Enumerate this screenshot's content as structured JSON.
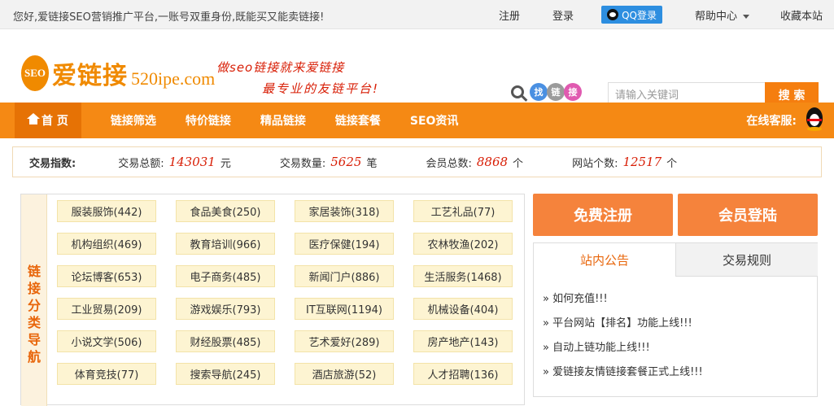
{
  "topbar": {
    "welcome": "您好,爱链接SEO营销推广平台,一账号双重身份,既能买又能卖链接!",
    "register": "注册",
    "login": "登录",
    "qq_login": "QQ登录",
    "help": "帮助中心",
    "bookmark": "收藏本站"
  },
  "logo": {
    "badge": "SEO",
    "name": "爱链接",
    "domain": "520ipe.com"
  },
  "slogan": {
    "line1": "做seo链接就来爱链接",
    "line2": "最专业的友链平台!"
  },
  "search": {
    "deco": [
      "找",
      "链",
      "接"
    ],
    "deco_colors": [
      "#4a90e2",
      "#9b9b9b",
      "#e05ab0"
    ],
    "placeholder": "请输入关键词",
    "button": "搜 索"
  },
  "nav": {
    "home": "首 页",
    "items": [
      "链接筛选",
      "特价链接",
      "精品链接",
      "链接套餐",
      "SEO资讯"
    ],
    "customer_service": "在线客服:"
  },
  "stats": {
    "label": "交易指数:",
    "items": [
      {
        "label": "交易总额:",
        "value": "143031",
        "unit": "元"
      },
      {
        "label": "交易数量:",
        "value": "5625",
        "unit": "笔"
      },
      {
        "label": "会员总数:",
        "value": "8868",
        "unit": "个"
      },
      {
        "label": "网站个数:",
        "value": "12517",
        "unit": "个"
      }
    ]
  },
  "categories": {
    "side_title": "链接分类导航",
    "items": [
      "服装服饰(442)",
      "食品美食(250)",
      "家居装饰(318)",
      "工艺礼品(77)",
      "机构组织(469)",
      "教育培训(966)",
      "医疗保健(194)",
      "农林牧渔(202)",
      "论坛博客(653)",
      "电子商务(485)",
      "新闻门户(886)",
      "生活服务(1468)",
      "工业贸易(209)",
      "游戏娱乐(793)",
      "IT互联网(1194)",
      "机械设备(404)",
      "小说文学(506)",
      "财经股票(485)",
      "艺术爱好(289)",
      "房产地产(143)",
      "体育竞技(77)",
      "搜索导航(245)",
      "酒店旅游(52)",
      "人才招聘(136)"
    ]
  },
  "side": {
    "free_register": "免费注册",
    "member_login": "会员登陆",
    "tab_notice": "站内公告",
    "tab_rules": "交易规则",
    "announcements": [
      "» 如何充值!!!",
      "» 平台网站【排名】功能上线!!!",
      "» 自动上链功能上线!!!",
      "» 爱链接友情链接套餐正式上线!!!"
    ]
  },
  "colors": {
    "accent": "#f58914",
    "accent_dark": "#e67205",
    "number_red": "#d81e06",
    "button_orange": "#f5833c"
  }
}
